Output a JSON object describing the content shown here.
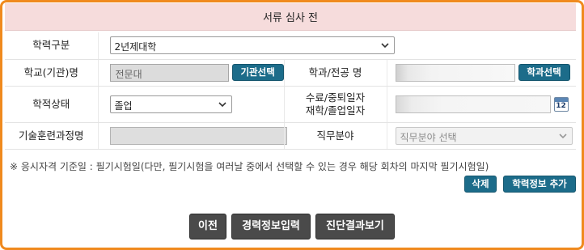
{
  "header": {
    "title": "서류 심사 전"
  },
  "form": {
    "education_type": {
      "label": "학력구분",
      "value": "2년제대학"
    },
    "school_name": {
      "label": "학교(기관)명",
      "value": "전문대",
      "button": "기관선택"
    },
    "major": {
      "label": "학과/전공 명",
      "value": "",
      "button": "학과선택"
    },
    "academic_status": {
      "label": "학적상태",
      "value": "졸업"
    },
    "dates": {
      "label_line1": "수료/중퇴일자",
      "label_line2": "재학/졸업일자",
      "value": "",
      "calendar_text": "12"
    },
    "training_course": {
      "label": "기술훈련과정명",
      "value": ""
    },
    "job_field": {
      "label": "직무분야",
      "value": "직무분야 선택"
    }
  },
  "note": "※ 응시자격 기준일 : 필기시험일(다만, 필기시험을 여러날 중에서 선택할 수 있는 경우 해당 회차의 마지막 필기시험일)",
  "actions": {
    "delete": "삭제",
    "add": "학력정보 추가"
  },
  "bottom": {
    "prev": "이전",
    "career": "경력정보입력",
    "result": "진단결과보기"
  },
  "colors": {
    "frame": "#f08a1e",
    "header_bg": "#f6dcdc",
    "teal_button": "#1c6c8a",
    "dark_button": "#4a4a4a"
  }
}
